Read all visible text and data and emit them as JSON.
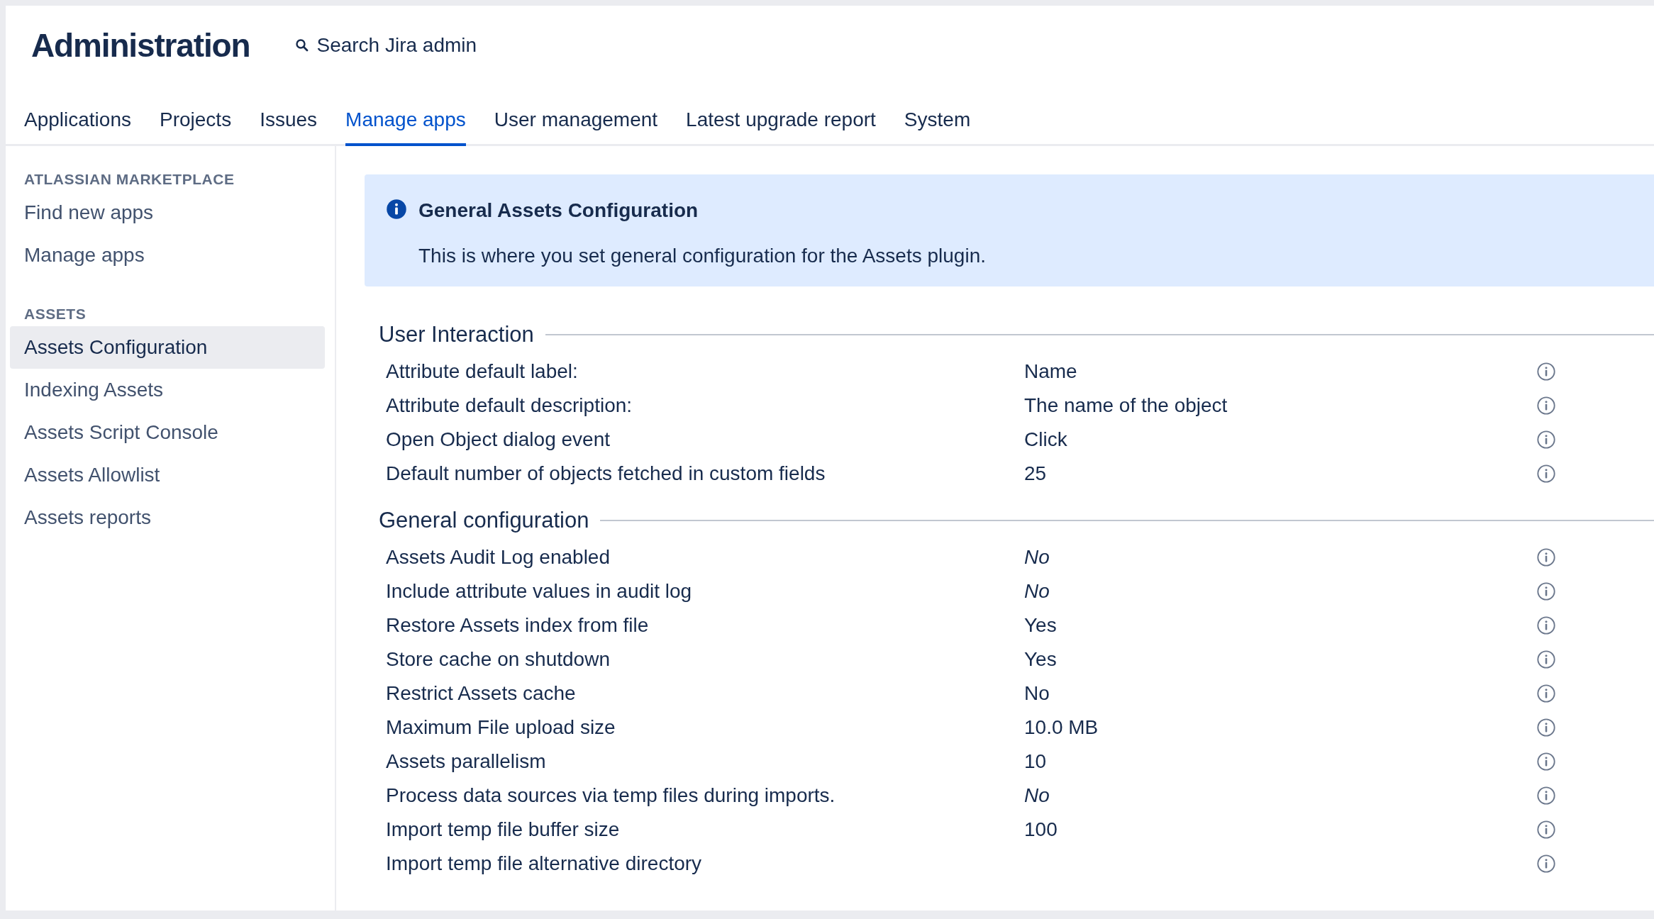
{
  "header": {
    "title": "Administration",
    "search": {
      "placeholder": "Search Jira admin"
    }
  },
  "tabs": [
    {
      "label": "Applications",
      "selected": false
    },
    {
      "label": "Projects",
      "selected": false
    },
    {
      "label": "Issues",
      "selected": false
    },
    {
      "label": "Manage apps",
      "selected": true
    },
    {
      "label": "User management",
      "selected": false
    },
    {
      "label": "Latest upgrade report",
      "selected": false
    },
    {
      "label": "System",
      "selected": false
    }
  ],
  "sidebar": {
    "sections": [
      {
        "heading": "ATLASSIAN MARKETPLACE",
        "items": [
          {
            "label": "Find new apps",
            "selected": false
          },
          {
            "label": "Manage apps",
            "selected": false
          }
        ]
      },
      {
        "heading": "ASSETS",
        "items": [
          {
            "label": "Assets Configuration",
            "selected": true
          },
          {
            "label": "Indexing Assets",
            "selected": false
          },
          {
            "label": "Assets Script Console",
            "selected": false
          },
          {
            "label": "Assets Allowlist",
            "selected": false
          },
          {
            "label": "Assets reports",
            "selected": false
          }
        ]
      }
    ]
  },
  "banner": {
    "title": "General Assets Configuration",
    "message": "This is where you set general configuration for the Assets plugin."
  },
  "sections": [
    {
      "title": "User Interaction",
      "rows": [
        {
          "label": "Attribute default label:",
          "value": "Name",
          "italic": false
        },
        {
          "label": "Attribute default description:",
          "value": "The name of the object",
          "italic": false
        },
        {
          "label": "Open Object dialog event",
          "value": "Click",
          "italic": false
        },
        {
          "label": "Default number of objects fetched in custom fields",
          "value": "25",
          "italic": false
        }
      ]
    },
    {
      "title": "General configuration",
      "rows": [
        {
          "label": "Assets Audit Log enabled",
          "value": "No",
          "italic": true
        },
        {
          "label": "Include attribute values in audit log",
          "value": "No",
          "italic": true
        },
        {
          "label": "Restore Assets index from file",
          "value": "Yes",
          "italic": false
        },
        {
          "label": "Store cache on shutdown",
          "value": "Yes",
          "italic": false
        },
        {
          "label": "Restrict Assets cache",
          "value": "No",
          "italic": false
        },
        {
          "label": "Maximum File upload size",
          "value": "10.0 MB",
          "italic": false
        },
        {
          "label": "Assets parallelism",
          "value": "10",
          "italic": false
        },
        {
          "label": "Process data sources via temp files during imports.",
          "value": "No",
          "italic": true
        },
        {
          "label": "Import temp file buffer size",
          "value": "100",
          "italic": false
        },
        {
          "label": "Import temp file alternative directory"
        }
      ]
    }
  ]
}
